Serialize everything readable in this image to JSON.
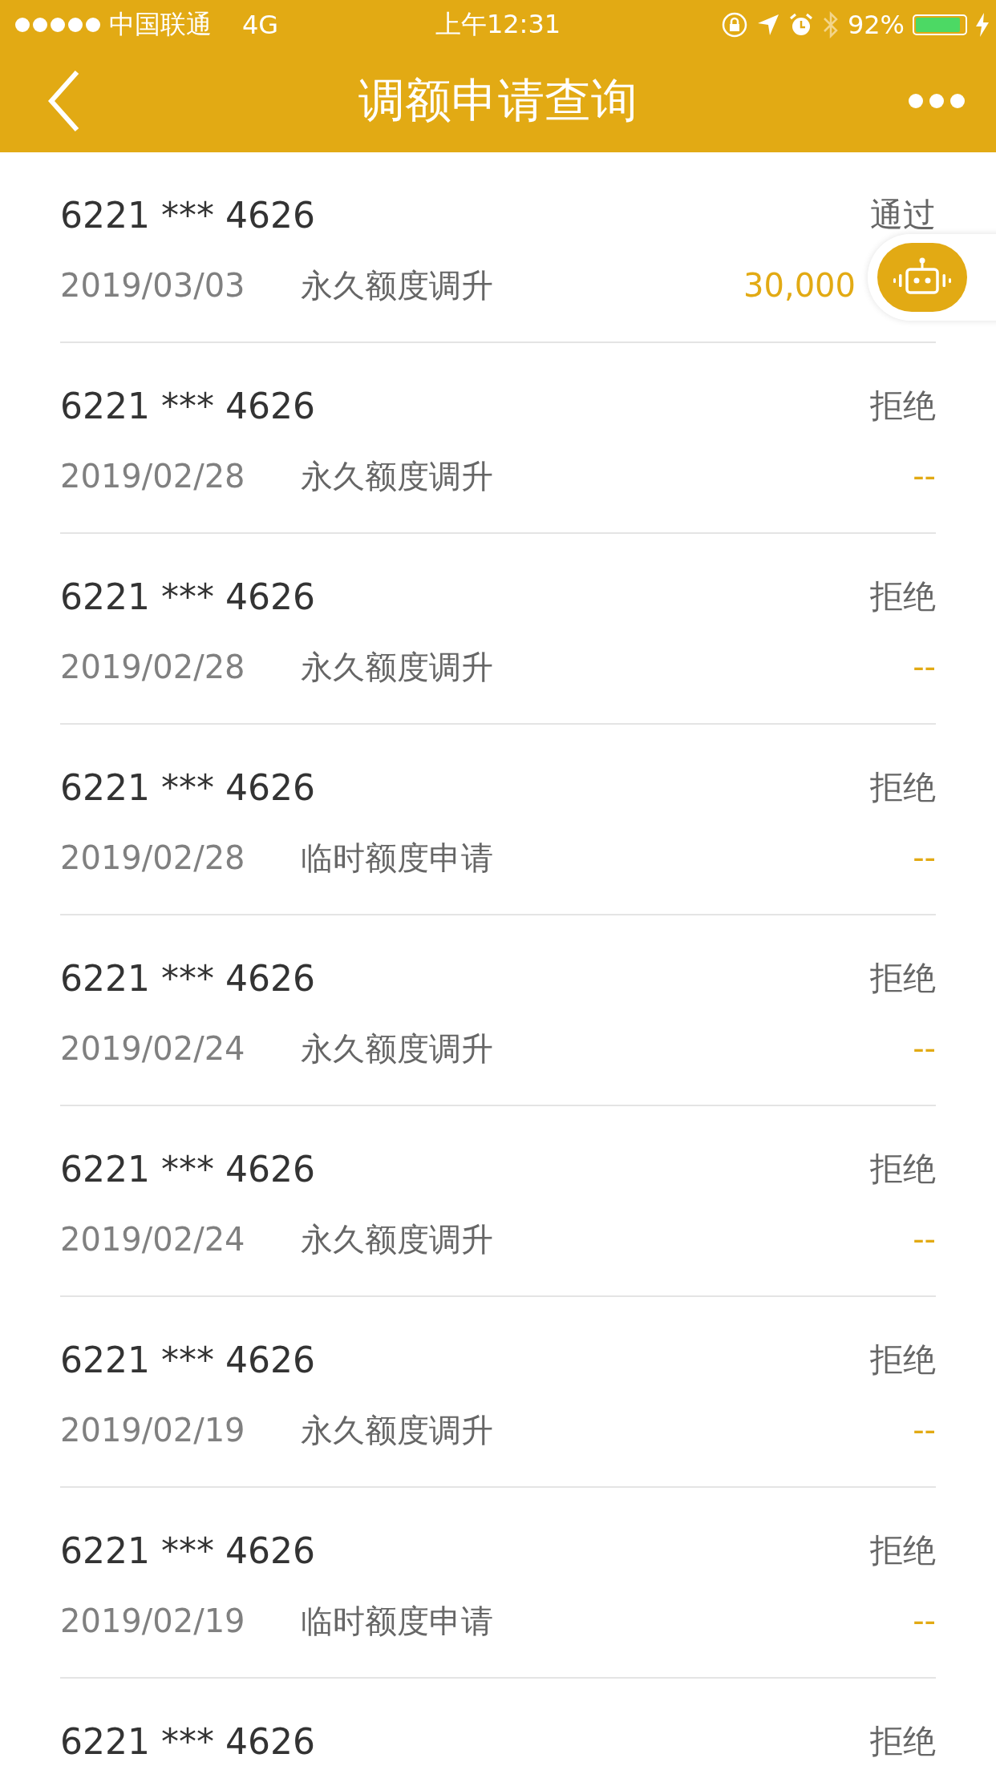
{
  "status_bar": {
    "carrier": "中国联通",
    "network": "4G",
    "time": "上午12:31",
    "battery_text": "92%",
    "battery": {
      "level": 0.92,
      "charging": true
    }
  },
  "nav": {
    "title": "调额申请查询"
  },
  "records": [
    {
      "card": "6221 *** 4626",
      "status": "通过",
      "date": "2019/03/03",
      "type": "永久额度调升",
      "amount": "30,000"
    },
    {
      "card": "6221 *** 4626",
      "status": "拒绝",
      "date": "2019/02/28",
      "type": "永久额度调升",
      "amount": "--"
    },
    {
      "card": "6221 *** 4626",
      "status": "拒绝",
      "date": "2019/02/28",
      "type": "永久额度调升",
      "amount": "--"
    },
    {
      "card": "6221 *** 4626",
      "status": "拒绝",
      "date": "2019/02/28",
      "type": "临时额度申请",
      "amount": "--"
    },
    {
      "card": "6221 *** 4626",
      "status": "拒绝",
      "date": "2019/02/24",
      "type": "永久额度调升",
      "amount": "--"
    },
    {
      "card": "6221 *** 4626",
      "status": "拒绝",
      "date": "2019/02/24",
      "type": "永久额度调升",
      "amount": "--"
    },
    {
      "card": "6221 *** 4626",
      "status": "拒绝",
      "date": "2019/02/19",
      "type": "永久额度调升",
      "amount": "--"
    },
    {
      "card": "6221 *** 4626",
      "status": "拒绝",
      "date": "2019/02/19",
      "type": "临时额度申请",
      "amount": "--"
    },
    {
      "card": "6221 *** 4626",
      "status": "拒绝"
    }
  ]
}
